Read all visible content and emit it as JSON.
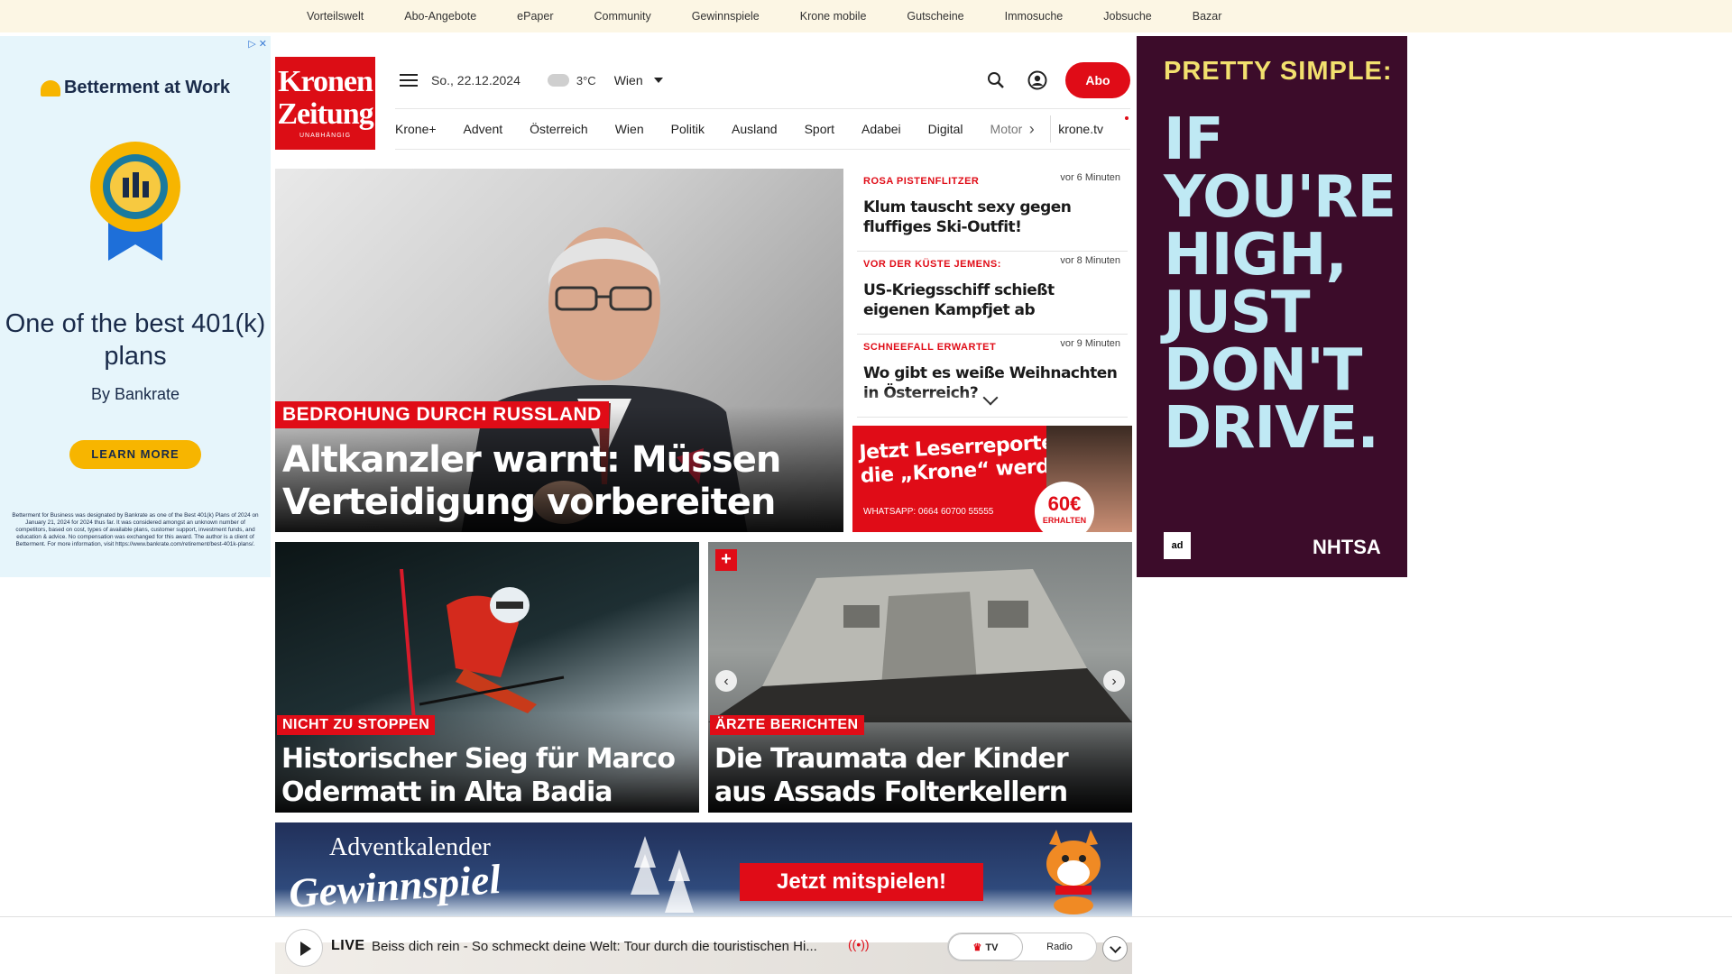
{
  "topbar": {
    "links": [
      "Vorteilswelt",
      "Abo-Angebote",
      "ePaper",
      "Community",
      "Gewinnspiele",
      "Krone mobile",
      "Gutscheine",
      "Immosuche",
      "Jobsuche",
      "Bazar"
    ]
  },
  "ad_left": {
    "brand": "Betterment at Work",
    "headline": "One of the best 401(k) plans",
    "by": "By Bankrate",
    "cta": "LEARN MORE",
    "fine_print": "Betterment for Business was designated by Bankrate as one of the Best 401(k) Plans of 2024 on January 21, 2024 for 2024 thus far. It was considered amongst an unknown number of competitors, based on cost, types of available plans, customer support, investment funds, and education & advice. No compensation was exchanged for this award. The author is a client of Betterment. For more information, visit https://www.bankrate.com/retirement/best-401k-plans/."
  },
  "ad_right": {
    "pre": "PRETTY SIMPLE:",
    "big": "IF YOU'RE HIGH, JUST DON'T DRIVE.",
    "ad_council": "ad",
    "nhtsa": "NHTSA"
  },
  "logo": {
    "line1": "Kronen",
    "line2": "Zeitung",
    "line3": "UNABHÄNGIG"
  },
  "header": {
    "date": "So., 22.12.2024",
    "temp": "3°C",
    "city": "Wien",
    "abo": "Abo"
  },
  "nav": {
    "items": [
      "Krone+",
      "Advent",
      "Österreich",
      "Wien",
      "Politik",
      "Ausland",
      "Sport",
      "Adabei",
      "Digital"
    ],
    "faded": "Motor",
    "tv": "krone.tv"
  },
  "hero": {
    "kicker": "BEDROHUNG DURCH RUSSLAND",
    "title": "Altkanzler warnt: Müssen Verteidigung vorbereiten"
  },
  "ticker": [
    {
      "kicker": "ROSA PISTENFLITZER",
      "time": "vor 6 Minuten",
      "title": "Klum tauscht sexy gegen fluffiges Ski-Outfit!"
    },
    {
      "kicker": "VOR DER KÜSTE JEMENS:",
      "time": "vor 8 Minuten",
      "title": "US-Kriegsschiff schießt eigenen Kampfjet ab"
    },
    {
      "kicker": "SCHNEEFALL ERWARTET",
      "time": "vor 9 Minuten",
      "title": "Wo gibt es weiße Weihnachten in Österreich?"
    }
  ],
  "promo": {
    "title": "Jetzt Leserreporter für die „Krone“ werden",
    "whatsapp": "WHATSAPP: 0664 60700 55555",
    "badge_value": "60€",
    "badge_sub": "ERHALTEN"
  },
  "cards": [
    {
      "kicker": "NICHT ZU STOPPEN",
      "title": "Historischer Sieg für Marco Odermatt in Alta Badia"
    },
    {
      "kicker": "ÄRZTE BERICHTEN",
      "title": "Die Traumata der Kinder aus Assads Folterkellern"
    }
  ],
  "advent": {
    "line1": "Adventkalender",
    "line2": "Gewinnspiel",
    "button": "Jetzt mitspielen!"
  },
  "livebar": {
    "label": "LIVE",
    "text": "Beiss dich rein - So schmeckt deine Welt: Tour durch die touristischen Hi...",
    "tv": "TV",
    "radio": "Radio"
  },
  "colors": {
    "brand_red": "#e00c17",
    "topbar_bg": "#fcf6e4",
    "ad_right_bg": "#3c0c2a",
    "ad_left_bg": "#e6f5fb"
  }
}
